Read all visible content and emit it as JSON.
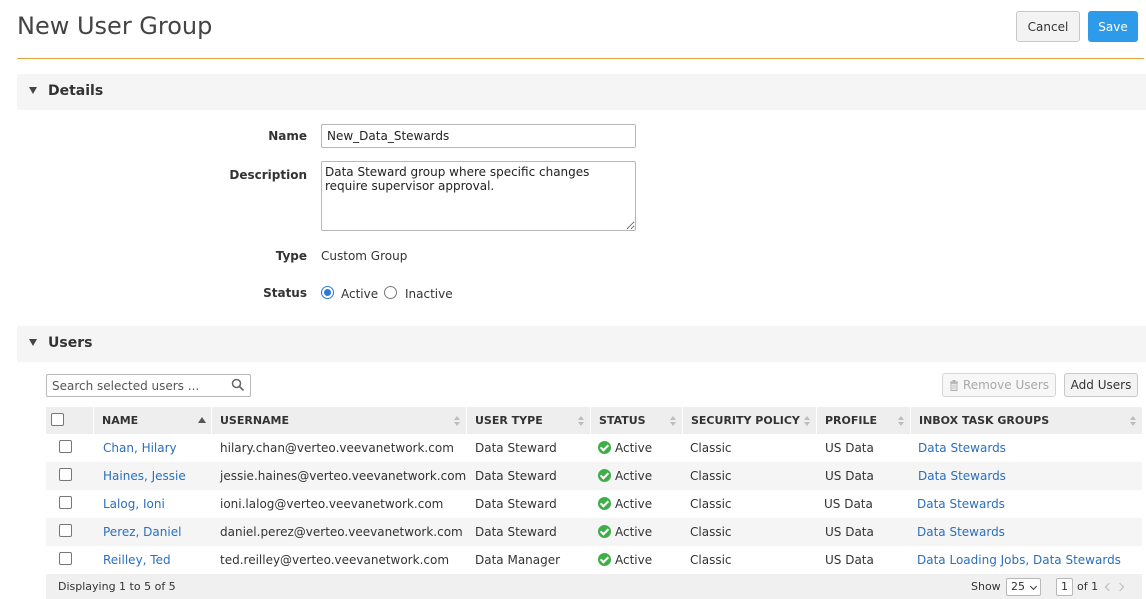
{
  "header": {
    "title": "New User Group",
    "cancel_label": "Cancel",
    "save_label": "Save"
  },
  "details": {
    "section_label": "Details",
    "name_label": "Name",
    "name_value": "New_Data_Stewards",
    "description_label": "Description",
    "description_value": "Data Steward group where specific changes require supervisor approval.",
    "type_label": "Type",
    "type_value": "Custom Group",
    "status_label": "Status",
    "status_options": [
      "Active",
      "Inactive"
    ],
    "status_selected": "Active"
  },
  "users": {
    "section_label": "Users",
    "search_placeholder": "Search selected users ...",
    "remove_label": "Remove Users",
    "add_label": "Add Users",
    "columns": [
      "NAME",
      "USERNAME",
      "USER TYPE",
      "STATUS",
      "SECURITY POLICY",
      "PROFILE",
      "INBOX TASK GROUPS"
    ],
    "rows": [
      {
        "name": "Chan, Hilary",
        "username": "hilary.chan@verteo.veevanetwork.com",
        "user_type": "Data Steward",
        "status": "Active",
        "security_policy": "Classic",
        "profile": "US Data",
        "inbox": "Data Stewards"
      },
      {
        "name": "Haines, Jessie",
        "username": "jessie.haines@verteo.veevanetwork.com",
        "user_type": "Data Steward",
        "status": "Active",
        "security_policy": "Classic",
        "profile": "US Data",
        "inbox": "Data Stewards"
      },
      {
        "name": "Lalog, Ioni",
        "username": "ioni.lalog@verteo.veevanetwork.com",
        "user_type": "Data Steward",
        "status": "Active",
        "security_policy": "Classic",
        "profile": "US Data",
        "inbox": "Data Stewards"
      },
      {
        "name": "Perez, Daniel",
        "username": "daniel.perez@verteo.veevanetwork.com",
        "user_type": "Data Steward",
        "status": "Active",
        "security_policy": "Classic",
        "profile": "US Data",
        "inbox": "Data Stewards"
      },
      {
        "name": "Reilley, Ted",
        "username": "ted.reilley@verteo.veevanetwork.com",
        "user_type": "Data Manager",
        "status": "Active",
        "security_policy": "Classic",
        "profile": "US Data",
        "inbox": "Data Loading Jobs, Data Stewards"
      }
    ],
    "footer": {
      "displaying": "Displaying 1 to 5 of 5",
      "show_label": "Show",
      "page_size": "25",
      "page": "1",
      "of_label": "of 1"
    }
  },
  "colors": {
    "accent": "#2e9bea",
    "rule": "#e8a23c",
    "link": "#2a6fbd",
    "status_ok": "#3fae49"
  }
}
